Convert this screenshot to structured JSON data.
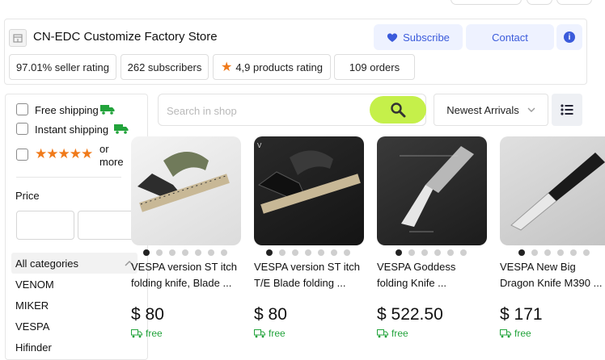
{
  "store": {
    "name": "CN-EDC Customize Factory Store",
    "subscribe_label": "Subscribe",
    "contact_label": "Contact",
    "info_icon": "i",
    "stats": {
      "seller_rating": "97.01% seller rating",
      "subscribers": "262 subscribers",
      "products_rating": "4,9 products rating",
      "orders": "109 orders"
    }
  },
  "filters": {
    "free_shipping": "Free shipping",
    "instant_shipping": "Instant shipping",
    "rating_stars": "★★★★★",
    "rating_or": "or",
    "rating_more": "more",
    "price_label": "Price",
    "min_price": "",
    "max_price": ""
  },
  "categories": {
    "header": "All categories",
    "items": [
      "VENOM",
      "MIKER",
      "VESPA",
      "Hifinder"
    ]
  },
  "search": {
    "placeholder": "Search in shop",
    "sort_label": "Newest Arrivals"
  },
  "products": [
    {
      "title_line1": "VESPA version ST itch",
      "title_line2": "folding knife, Blade ...",
      "price": "$ 80",
      "shipping": "free",
      "dot_count": 7,
      "active_dot": 0
    },
    {
      "title_line1": "VESPA version ST itch",
      "title_line2": "T/E Blade folding ...",
      "price": "$ 80",
      "shipping": "free",
      "dot_count": 7,
      "active_dot": 0
    },
    {
      "title_line1": "VESPA Goddess",
      "title_line2": "folding Knife ...",
      "price": "$ 522.50",
      "shipping": "free",
      "dot_count": 6,
      "active_dot": 0
    },
    {
      "title_line1": "VESPA New Big",
      "title_line2": "Dragon Knife M390 ...",
      "price": "$ 171",
      "shipping": "free",
      "dot_count": 6,
      "active_dot": 0
    }
  ],
  "colors": {
    "accent": "#3b5bdb",
    "search_button": "#c5f04a",
    "shipping_green": "#22a33b",
    "star_orange": "#f07a1a"
  }
}
